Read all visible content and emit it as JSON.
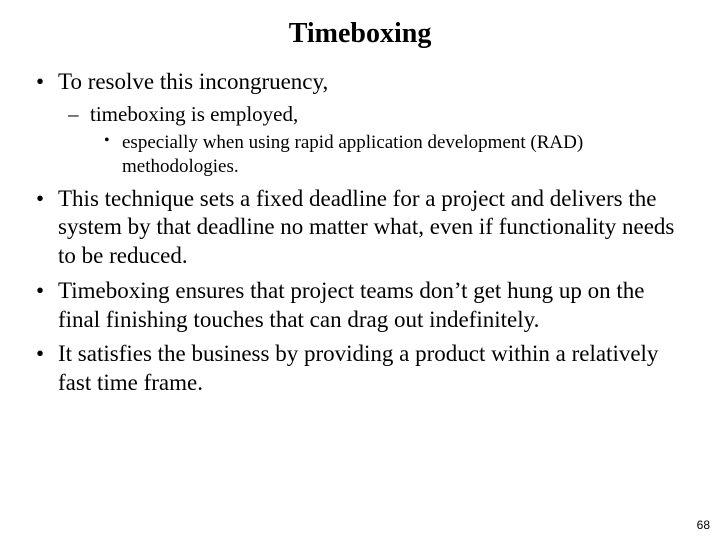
{
  "title": "Timeboxing",
  "bullets": {
    "b1": "To resolve this incongruency,",
    "b1_1": "timeboxing is employed,",
    "b1_1_1": "especially when using rapid application development (RAD) methodologies.",
    "b2": "This technique sets a fixed deadline for a project and delivers the system by that deadline no matter what, even if functionality needs to be reduced.",
    "b3": "Timeboxing ensures that project teams don’t get hung up on the final finishing touches that can drag out indefinitely.",
    "b4": "It satisfies the business by providing a product within a relatively fast time frame."
  },
  "page_number": "68"
}
